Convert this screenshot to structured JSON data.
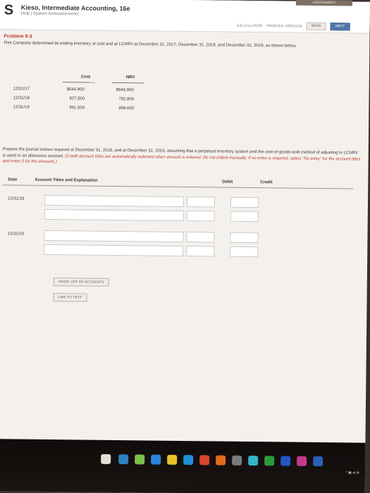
{
  "header": {
    "logo": "S",
    "book_title": "Kieso, Intermediate Accounting, 16e",
    "sub_links": "Help | System Announcements",
    "top_tab": "ASSIGNMENT",
    "tools": [
      "CALCULATOR",
      "PRINTER VERSION"
    ],
    "back_label": "BACK",
    "next_label": "NEXT"
  },
  "problem": {
    "number": "Problem 9-3",
    "description": "Flint Company determined its ending inventory at cost and at LCNRV at December 31, 2017, December 31, 2018, and December 31, 2019, as shown below."
  },
  "inventory_table": {
    "headers": [
      "Cost",
      "NRV"
    ],
    "rows": [
      {
        "date": "12/31/17",
        "cost": "$644,900",
        "nrv": "$644,900"
      },
      {
        "date": "12/31/18",
        "cost": "827,500",
        "nrv": "752,800"
      },
      {
        "date": "12/31/19",
        "cost": "991,500",
        "nrv": "909,600"
      }
    ]
  },
  "instructions": {
    "text": "Prepare the journal entries required at December 31, 2018, and at December 31, 2019, assuming that a perpetual inventory system and the cost-of-goods-sold method of adjusting to LCNRV is used or an allowance account.",
    "note": "(Credit account titles are automatically indented when amount is entered. Do not indent manually. If no entry is required, select \"No entry\" for the account titles and enter 0 for the amounts.)"
  },
  "journal": {
    "headers": {
      "date": "Date",
      "account": "Account Titles and Explanation",
      "debit": "Debit",
      "credit": "Credit"
    },
    "entries": [
      {
        "date": "12/31/18"
      },
      {
        "date": "12/31/19"
      }
    ],
    "show_list_label": "SHOW LIST OF ACCOUNTS",
    "link_label": "LINK TO TEXT"
  },
  "taskbar": {
    "icon_colors": [
      "#e8e0d6",
      "#2f7fbf",
      "#7cc04b",
      "#2a84d9",
      "#e8c32a",
      "#1e8fd6",
      "#d9472b",
      "#e26a1a",
      "#7a7a7a",
      "#2fb6c8",
      "#2a9a3a",
      "#2255c7",
      "#c43a8a",
      "#2d5fb5"
    ],
    "tray_text": "^ ▣ ◂) ⊕"
  }
}
